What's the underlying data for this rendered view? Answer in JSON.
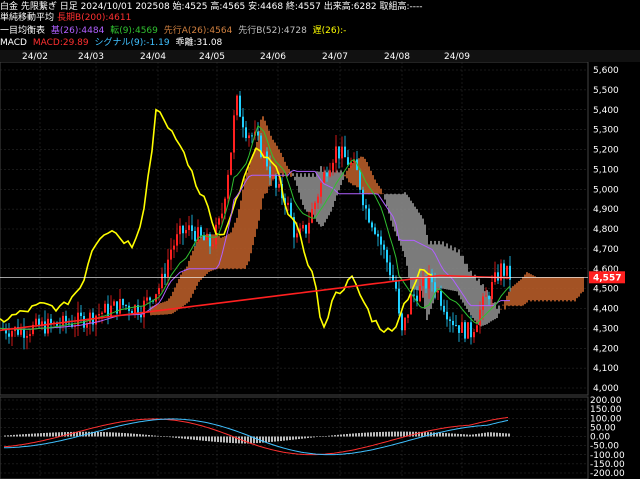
{
  "header": {
    "line1": "白金 先限繋ぎ 日足 2024/10/01 202508 始:4525 高:4565 安:4468 終:4557 出来高:6282 取組高:----",
    "line2_label": "単純移動平均",
    "line2_value": "長期B(200):4611",
    "line3_label": "一目均衡表",
    "line3_items": [
      {
        "text": "基(26):4484",
        "color": "#b060ff"
      },
      {
        "text": "転(9):4569",
        "color": "#30c030"
      },
      {
        "text": "先行A(26):4564",
        "color": "#d08040"
      },
      {
        "text": "先行B(52):4728",
        "color": "#c0c0c0"
      },
      {
        "text": "遅(26):-",
        "color": "#ffff00"
      }
    ],
    "line4_label": "MACD",
    "line4_items": [
      {
        "text": "MACD:29.89",
        "color": "#ff3030"
      },
      {
        "text": "シグナル(9):-1.19",
        "color": "#40c0ff"
      },
      {
        "text": "乖離:31.08",
        "color": "#ffffff"
      }
    ]
  },
  "x_axis": {
    "labels": [
      "24/02",
      "24/03",
      "24/04",
      "24/05",
      "24/06",
      "24/07",
      "24/08",
      "24/09"
    ]
  },
  "price_axis": {
    "labels": [
      "5,600",
      "5,500",
      "5,400",
      "5,300",
      "5,200",
      "5,100",
      "5,000",
      "4,900",
      "4,800",
      "4,700",
      "4,600",
      "4,500",
      "4,400",
      "4,300",
      "4,200",
      "4,100",
      "4,000"
    ],
    "current": "4,557"
  },
  "macd_axis": {
    "labels": [
      "200.00",
      "150.00",
      "100.00",
      "50.00",
      "0.00",
      "-50.00",
      "-100.00",
      "-150.00",
      "-200.00"
    ]
  },
  "colors": {
    "up": "#ff2020",
    "down": "#20d0ff",
    "sma200": "#ff2020",
    "kijun": "#b060ff",
    "tenkan": "#30c030",
    "chikou": "#ffff00",
    "cloud_bull": "#c0602a",
    "cloud_bear": "#909090",
    "current_price_bg": "#ff2020"
  },
  "chart_data": {
    "type": "line",
    "price_series_samples": [
      [
        0,
        4300
      ],
      [
        20,
        4290
      ],
      [
        40,
        4310
      ],
      [
        60,
        4320
      ],
      [
        80,
        4340
      ],
      [
        100,
        4380
      ],
      [
        120,
        4420
      ],
      [
        140,
        4400
      ],
      [
        160,
        4520
      ],
      [
        170,
        4700
      ],
      [
        180,
        4780
      ],
      [
        190,
        4800
      ],
      [
        200,
        4750
      ],
      [
        210,
        4720
      ],
      [
        220,
        4850
      ],
      [
        230,
        5200
      ],
      [
        235,
        5450
      ],
      [
        245,
        5300
      ],
      [
        255,
        5250
      ],
      [
        265,
        5150
      ],
      [
        275,
        5000
      ],
      [
        285,
        4950
      ],
      [
        295,
        4750
      ],
      [
        305,
        4800
      ],
      [
        315,
        4950
      ],
      [
        325,
        5100
      ],
      [
        335,
        5200
      ],
      [
        345,
        5150
      ],
      [
        355,
        5100
      ],
      [
        365,
        4900
      ],
      [
        375,
        4800
      ],
      [
        385,
        4650
      ],
      [
        395,
        4500
      ],
      [
        400,
        4250
      ],
      [
        410,
        4450
      ],
      [
        420,
        4500
      ],
      [
        430,
        4550
      ],
      [
        440,
        4450
      ],
      [
        450,
        4350
      ],
      [
        460,
        4300
      ],
      [
        470,
        4280
      ],
      [
        480,
        4400
      ],
      [
        490,
        4500
      ],
      [
        500,
        4600
      ],
      [
        510,
        4557
      ]
    ]
  }
}
